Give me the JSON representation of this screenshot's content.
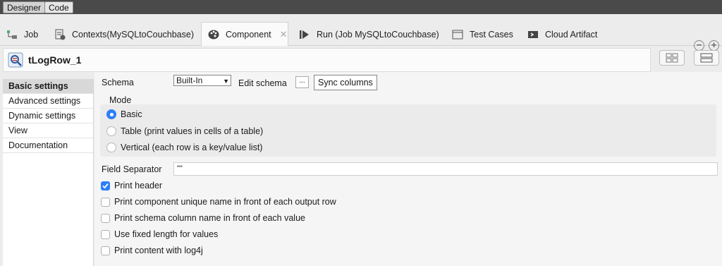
{
  "perspectives": {
    "designer": "Designer",
    "code": "Code"
  },
  "tabs": [
    {
      "label": "Job",
      "icon": "job-icon"
    },
    {
      "label": "Contexts(MySQLtoCouchbase)",
      "icon": "contexts-icon"
    },
    {
      "label": "Component",
      "icon": "component-palette-icon",
      "active": true
    },
    {
      "label": "Run (Job MySQLtoCouchbase)",
      "icon": "run-icon"
    },
    {
      "label": "Test Cases",
      "icon": "test-cases-icon"
    },
    {
      "label": "Cloud Artifact",
      "icon": "cloud-artifact-icon"
    }
  ],
  "component": {
    "title": "tLogRow_1"
  },
  "sidebar": {
    "items": [
      {
        "label": "Basic settings"
      },
      {
        "label": "Advanced settings"
      },
      {
        "label": "Dynamic settings"
      },
      {
        "label": "View"
      },
      {
        "label": "Documentation"
      }
    ]
  },
  "settings": {
    "schema_label": "Schema",
    "schema_value": "Built-In",
    "edit_schema_label": "Edit schema",
    "edit_schema_button": "...",
    "sync_columns": "Sync columns",
    "mode_label": "Mode",
    "modes": [
      {
        "label": "Basic",
        "selected": true
      },
      {
        "label": "Table (print values in cells of a table)",
        "selected": false
      },
      {
        "label": "Vertical (each row is a key/value list)",
        "selected": false
      }
    ],
    "field_separator_label": "Field Separator",
    "field_separator_value": "\"\"",
    "options": [
      {
        "label": "Print header",
        "checked": true
      },
      {
        "label": "Print component unique name in front of each output row",
        "checked": false
      },
      {
        "label": "Print schema column name in front of each value",
        "checked": false
      },
      {
        "label": "Use fixed length for values",
        "checked": false
      },
      {
        "label": "Print content with log4j",
        "checked": false
      }
    ]
  },
  "colors": {
    "accent": "#2d7ff9",
    "topbar": "#4a4a4a"
  }
}
